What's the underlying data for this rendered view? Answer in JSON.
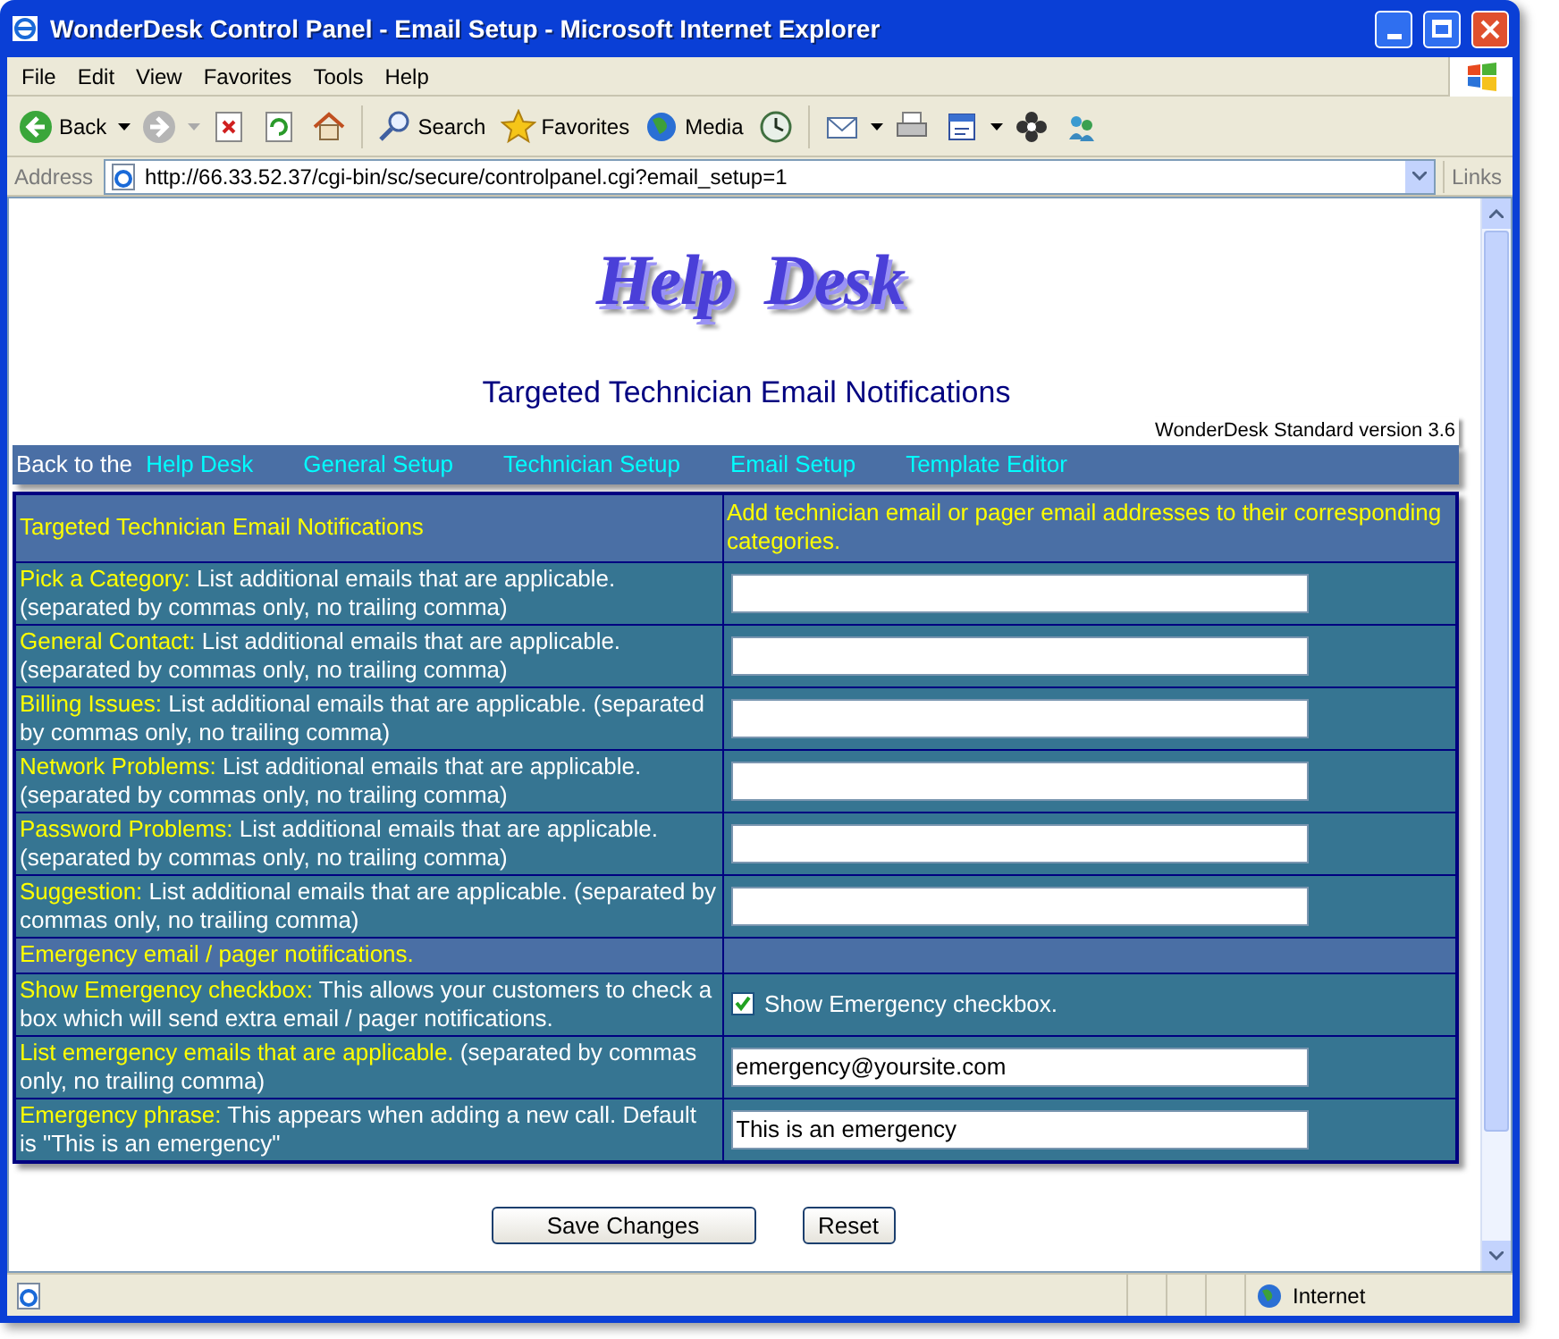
{
  "window": {
    "title": "WonderDesk Control Panel - Email Setup - Microsoft Internet Explorer"
  },
  "menu_bar": [
    "File",
    "Edit",
    "View",
    "Favorites",
    "Tools",
    "Help"
  ],
  "toolbar": [
    {
      "kind": "back",
      "label": "Back"
    },
    {
      "kind": "forward"
    },
    {
      "kind": "stop"
    },
    {
      "kind": "refresh"
    },
    {
      "kind": "home"
    },
    {
      "kind": "search",
      "label": "Search"
    },
    {
      "kind": "favorites",
      "label": "Favorites"
    },
    {
      "kind": "media",
      "label": "Media"
    },
    {
      "kind": "history"
    },
    {
      "kind": "mail"
    },
    {
      "kind": "print"
    },
    {
      "kind": "edit"
    },
    {
      "kind": "messenger"
    },
    {
      "kind": "discuss"
    }
  ],
  "address_bar": {
    "label": "Address",
    "url": "http://66.33.52.37/cgi-bin/sc/secure/controlpanel.cgi?email_setup=1",
    "links": "Links"
  },
  "page": {
    "logo": "Help  Desk",
    "heading": "Targeted Technician Email Notifications",
    "version": "WonderDesk Standard version 3.6",
    "nav": {
      "prefix": "Back to the",
      "links": [
        "Help Desk",
        "General Setup",
        "Technician Setup",
        "Email Setup",
        "Template Editor"
      ]
    },
    "table": {
      "header": [
        "Targeted Technician Email Notifications",
        "Add technician email or pager email addresses to their corresponding categories."
      ],
      "rows": [
        {
          "kind": "field",
          "label": "Pick a Category:",
          "text": "List additional emails that are applicable. (separated by commas only, no trailing comma)"
        },
        {
          "kind": "field",
          "label": "General Contact:",
          "text": "List additional emails that are applicable. (separated by commas only, no trailing comma)"
        },
        {
          "kind": "field",
          "label": "Billing Issues:",
          "text": "List additional emails that are applicable. (separated by commas only, no trailing comma)"
        },
        {
          "kind": "field",
          "label": "Network Problems:",
          "text": "List additional emails that are applicable. (separated by commas only, no trailing comma)"
        },
        {
          "kind": "field",
          "label": "Password Problems:",
          "text": "List additional emails that are applicable. (separated by commas only, no trailing comma)"
        },
        {
          "kind": "field",
          "label": "Suggestion:",
          "text": "List additional emails that are applicable. (separated by commas only, no trailing comma)"
        },
        {
          "kind": "section",
          "label": "Emergency email / pager notifications."
        },
        {
          "kind": "checkbox",
          "label": "Show Emergency checkbox:",
          "text": "This allows your customers to check a box which will send extra email / pager notifications.",
          "checked": true,
          "option": "Show Emergency checkbox."
        },
        {
          "kind": "field",
          "label": "List emergency emails that are applicable.",
          "text": "(separated by commas only, no trailing comma)",
          "value": "emergency@yoursite.com"
        },
        {
          "kind": "field",
          "label": "Emergency phrase:",
          "text": "This appears when adding a new call. Default is \"This is an emergency\"",
          "value": "This is an emergency"
        }
      ]
    },
    "buttons": [
      "Save Changes",
      "Reset"
    ]
  },
  "status_bar": {
    "zone": "Internet"
  }
}
